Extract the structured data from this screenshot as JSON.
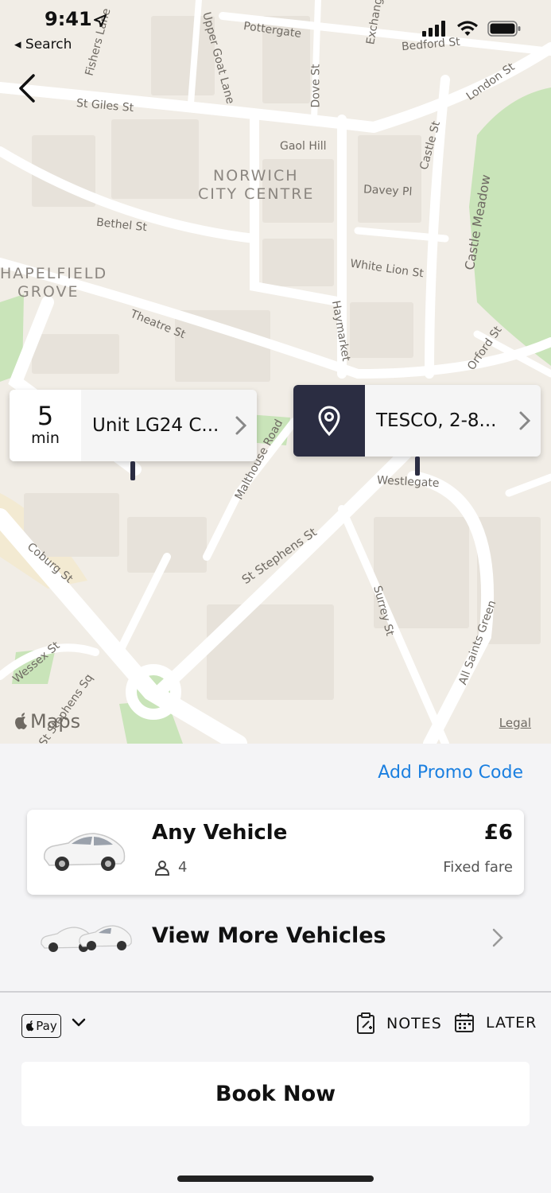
{
  "status_bar": {
    "time": "9:41",
    "back_to": "◂ Search"
  },
  "map": {
    "area_labels": [
      "NORWICH",
      "CITY CENTRE",
      "HAPELFIELD",
      "GROVE"
    ],
    "street_labels": [
      "Pottergate",
      "Bedford St",
      "St Giles St",
      "Gaol Hill",
      "Davey Pl",
      "Bethel St",
      "White Lion St",
      "Theatre St",
      "Haymarket",
      "Castle St",
      "Castle Meadow",
      "London St",
      "Dove St",
      "Upper Goat Lane",
      "Orford St",
      "Westlegate",
      "Malthouse Road",
      "St Stephens St",
      "Surrey St",
      "All Saints Green",
      "Coburg St",
      "Wessex St",
      "St Stephens Sq",
      "Fishers Lane",
      "Exchange St"
    ],
    "maps_brand": "Maps",
    "legal": "Legal"
  },
  "pickup": {
    "eta_value": "5",
    "eta_unit": "min",
    "address": "Unit LG24 C..."
  },
  "dropoff": {
    "address": "TESCO, 2-8..."
  },
  "sheet": {
    "promo": "Add Promo Code",
    "vehicle": {
      "name": "Any Vehicle",
      "seats": "4",
      "price": "£6",
      "fare_type": "Fixed fare"
    },
    "more_vehicles": "View More Vehicles",
    "payment": {
      "method": "Pay"
    },
    "notes_label": "NOTES",
    "later_label": "LATER",
    "book_label": "Book Now"
  },
  "colors": {
    "accent": "#1a7fe0",
    "marker_dark": "#2b2d42",
    "park_green": "#c9e4b9"
  }
}
